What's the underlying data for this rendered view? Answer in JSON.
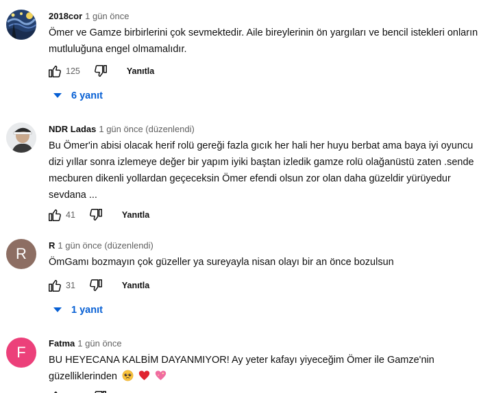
{
  "comments": [
    {
      "author": "2018cor",
      "meta": "1 gün önce",
      "text": "Ömer ve Gamze birbirlerini çok sevmektedir. Aile bireylerinin ön yargıları ve bencil istekleri onların mutluluğuna engel olmamalıdır.",
      "likes": "125",
      "reply_label": "Yanıtla",
      "replies_label": "6 yanıt",
      "avatar_icon": "starry-night-avatar"
    },
    {
      "author": "NDR Ladas",
      "meta": "1 gün önce (düzenlendi)",
      "text": "Bu Ömer'in abisi olacak herif rolü gereği fazla gıcık her hali her huyu berbat ama baya  iyi oyuncu dizi yıllar sonra izlemeye değer bir yapım iyiki baştan izledik gamze rolü olağanüstü zaten .sende mecburen dikenli yollardan geçeceksin Ömer efendi olsun zor olan daha güzeldir yürüyedur sevdana ...",
      "likes": "41",
      "reply_label": "Yanıtla",
      "avatar_icon": "person-photo-avatar"
    },
    {
      "author": "R",
      "meta": "1 gün önce (düzenlendi)",
      "text": "ÖmGamı bozmayın çok güzeller ya sureyayla nisan olayı bir an önce bozulsun",
      "likes": "31",
      "reply_label": "Yanıtla",
      "replies_label": "1 yanıt",
      "avatar_letter": "R",
      "avatar_color": "#8d6e63"
    },
    {
      "author": "Fatma",
      "meta": "1 gün önce",
      "text": "BU HEYECANA KALBİM DAYANMIYOR! Ay yeter kafayı yiyeceğim Ömer ile Gamze'nin güzelliklerinden",
      "emojis": [
        "pleading-face-emoji",
        "red-heart-emoji",
        "sparkling-heart-emoji"
      ],
      "avatar_letter": "F",
      "avatar_color": "#ec407a"
    }
  ],
  "colors": {
    "link_blue": "#065fd4",
    "meta_gray": "#606060",
    "text": "#0f0f0f"
  }
}
